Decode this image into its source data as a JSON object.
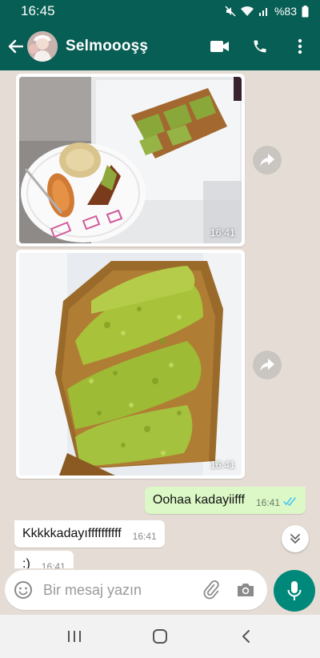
{
  "status_bar": {
    "time": "16:45",
    "battery": "%83",
    "icons": [
      "mute-icon",
      "wifi-icon",
      "signal-icon",
      "battery-icon"
    ]
  },
  "header": {
    "contact_name": "Selmoooşş",
    "icons": [
      "back-arrow-icon",
      "video-call-icon",
      "phone-icon",
      "more-vert-icon"
    ]
  },
  "messages": {
    "image1_time": "16:41",
    "image2_time": "16:41",
    "outgoing": {
      "text": "Oohaa kadayiifff",
      "time": "16:41",
      "status": "read"
    },
    "incoming1": {
      "text": "Kkkkkadayıffffffffff",
      "time": "16:41"
    },
    "incoming2": {
      "text": ":)",
      "time": "16:41"
    }
  },
  "input": {
    "placeholder": "Bir mesaj yazın",
    "icons": [
      "emoji-icon",
      "attach-icon",
      "camera-icon",
      "mic-icon"
    ]
  },
  "colors": {
    "header": "#075e54",
    "chat_bg": "#e5ddd5",
    "outgoing_bubble": "#dcf8c6",
    "accent": "#00897b",
    "read_ticks": "#4fc3f7"
  }
}
